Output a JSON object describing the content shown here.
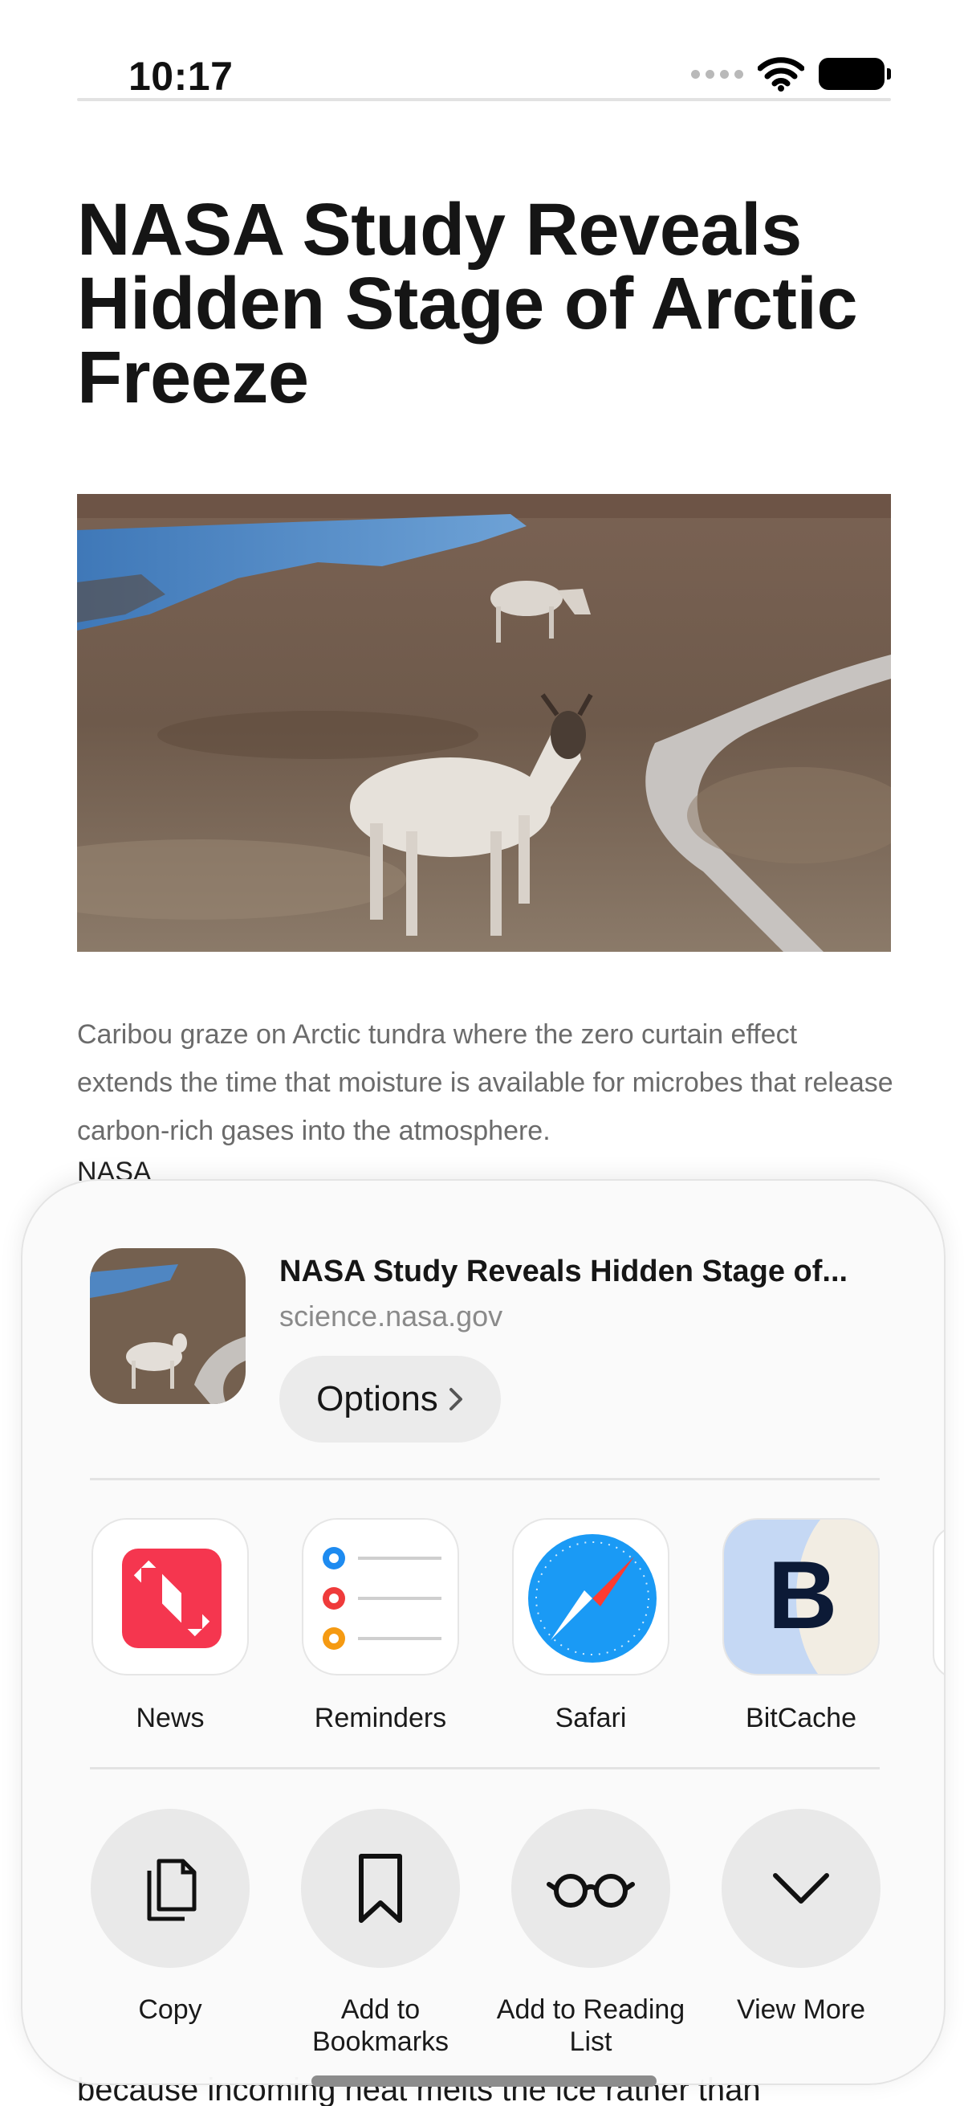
{
  "status_bar": {
    "time": "10:17"
  },
  "article": {
    "headline": "NASA Study Reveals Hidden Stage of Arctic Freeze",
    "caption": "Caribou graze on Arctic tundra where the zero curtain effect extends the time that moisture is available for microbes that release carbon-rich gases into the atmosphere.",
    "credit": "NASA",
    "continued_text": "because incoming heat melts the ice rather than"
  },
  "share_sheet": {
    "title": "NASA Study Reveals Hidden Stage of...",
    "url": "science.nasa.gov",
    "options_label": "Options",
    "apps": [
      {
        "label": "News",
        "icon": "news-icon"
      },
      {
        "label": "Reminders",
        "icon": "reminders-icon"
      },
      {
        "label": "Safari",
        "icon": "safari-icon"
      },
      {
        "label": "BitCache",
        "icon": "bitcache-icon"
      }
    ],
    "actions": [
      {
        "label": "Copy",
        "icon": "copy-icon"
      },
      {
        "label": "Add to Bookmarks",
        "icon": "bookmark-icon"
      },
      {
        "label": "Add to Reading List",
        "icon": "glasses-icon"
      },
      {
        "label": "View More",
        "icon": "chevron-down-icon"
      }
    ]
  }
}
